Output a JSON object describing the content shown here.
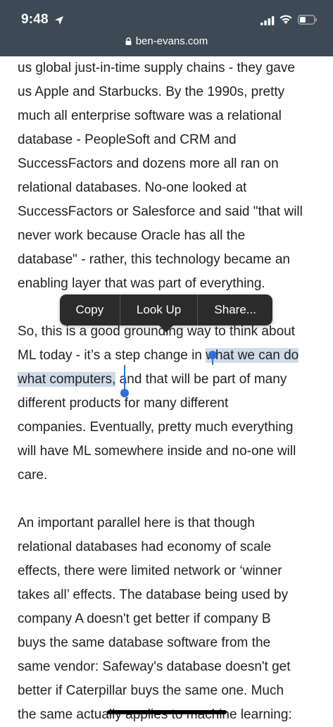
{
  "status_bar": {
    "time": "9:48",
    "location_icon": "location-arrow-icon",
    "signal_icon": "cellular-signal-icon",
    "wifi_icon": "wifi-icon",
    "battery_icon": "battery-icon"
  },
  "url_bar": {
    "domain": "ben-evans.com",
    "lock_icon": "lock-icon"
  },
  "article": {
    "paragraph1": [
      "us global just-in-time supply chains - they gave",
      "us Apple and Starbucks. By the 1990s, pretty",
      "much all enterprise software was a relational",
      "database - PeopleSoft and CRM and",
      "SuccessFactors and dozens more all ran on",
      "relational databases. No-one looked at",
      "SuccessFactors or Salesforce and said \"that will",
      "never work because Oracle has all the",
      "database\" - rather, this technology became an",
      "enabling layer that was part of everything."
    ],
    "paragraph2": {
      "line1": "So, this is a good grounding way to think about",
      "line2_before": "ML today - it’s a step change in ",
      "line2_selected": "what we can do",
      "line3_selected": "what computers,",
      "line3_after": " and that will be part of many",
      "rest": [
        "different products for many different",
        "companies. Eventually, pretty much everything",
        "will have ML somewhere inside and no-one will",
        "care."
      ]
    },
    "paragraph3": [
      "An important parallel here is that though",
      "relational databases had economy of scale",
      "effects, there were limited network or ‘winner",
      "takes all’ effects. The database being used by",
      "company A doesn't get better if company B",
      "buys the same database software from the",
      "same vendor: Safeway's database doesn't get",
      "better if Caterpillar buys the same one. Much",
      "the same actually applies to machine learning:"
    ]
  },
  "callout_menu": {
    "copy": "Copy",
    "look_up": "Look Up",
    "share": "Share..."
  },
  "colors": {
    "header_bg": "#3d4a55",
    "selection_bg": "#cfdbe9",
    "handle": "#2f6fd6",
    "callout_bg": "#2b2b2b"
  }
}
